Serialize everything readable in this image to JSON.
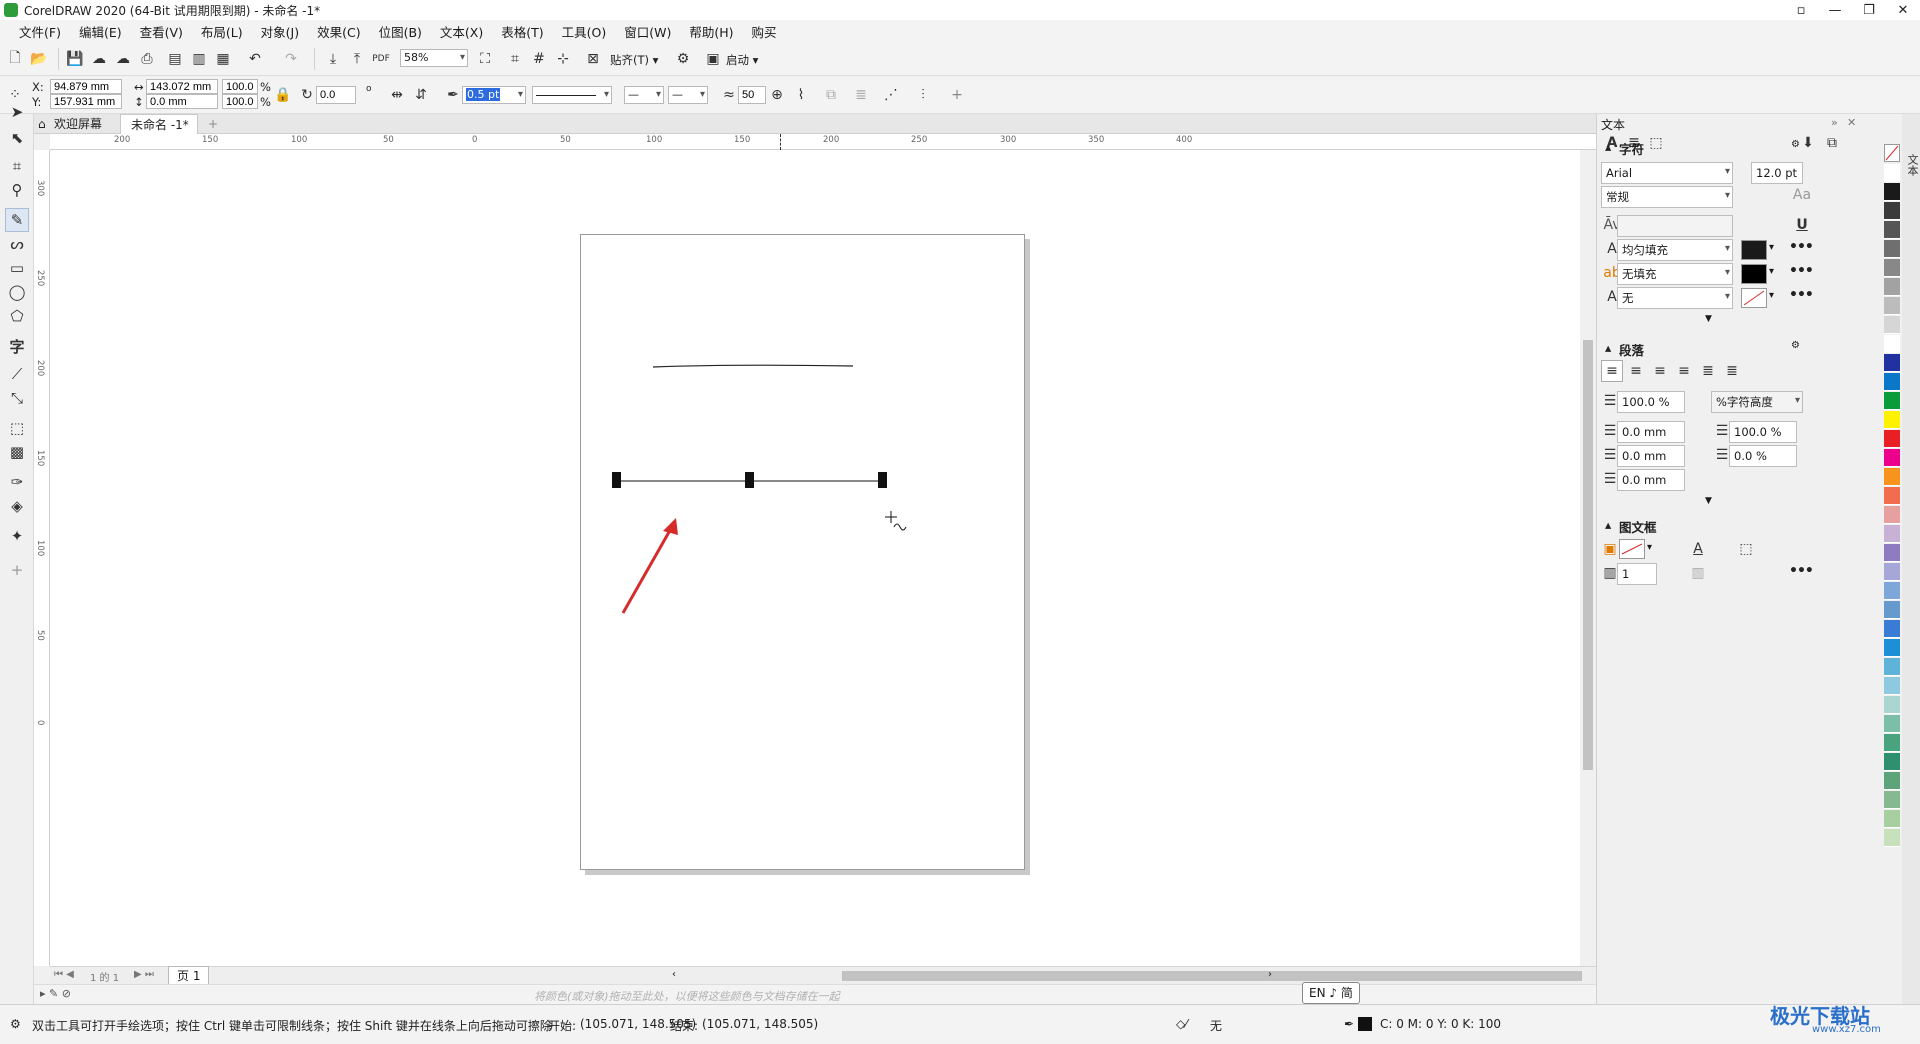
{
  "window": {
    "title": "CorelDRAW 2020 (64-Bit 试用期限到期) - 未命名 -1*"
  },
  "menu": [
    "文件(F)",
    "编辑(E)",
    "查看(V)",
    "布局(L)",
    "对象(J)",
    "效果(C)",
    "位图(B)",
    "文本(X)",
    "表格(T)",
    "工具(O)",
    "窗口(W)",
    "帮助(H)",
    "购买"
  ],
  "toolbar1": {
    "zoom": "58%",
    "snap_label": "贴齐(T)",
    "launch_label": "启动"
  },
  "toolbar2": {
    "x_label": "X:",
    "x_value": "94.879 mm",
    "y_label": "Y:",
    "y_value": "157.931 mm",
    "width_value": "143.072 mm",
    "height_value": "0.0 mm",
    "scale_x": "100.0",
    "scale_y": "100.0",
    "percent": "%",
    "rotation": "0.0",
    "degree": "o",
    "outline_width": "0.5 pt",
    "smoothing": "50"
  },
  "tabs": {
    "welcome": "欢迎屏幕",
    "document": "未命名 -1*"
  },
  "ruler_h": [
    "200",
    "150",
    "100",
    "50",
    "0",
    "50",
    "100",
    "150",
    "200",
    "250",
    "300",
    "350",
    "400"
  ],
  "ruler_v": [
    "300",
    "250",
    "200",
    "150",
    "100",
    "50",
    "0"
  ],
  "page_nav": {
    "count": "1 的 1",
    "page_tab": "页 1"
  },
  "tray_hint": "将颜色(或对象)拖动至此处，以便将这些颜色与文档存储在一起",
  "ime": "EN ♪ 简",
  "status": {
    "hint": "双击工具可打开手绘选项；按住 Ctrl 键单击可限制线条；按住 Shift 键并在线条上向后拖动可擦除",
    "start_label": "开始:",
    "start_value": "(105.071, 148.505)",
    "end_label": "结束:",
    "end_value": "(105.071, 148.505)",
    "fill_label": "无",
    "cmyk": "C: 0 M: 0 Y: 0 K: 100"
  },
  "panel": {
    "title": "文本",
    "section_char": "字符",
    "font_name": "Arial",
    "font_size": "12.0 pt",
    "font_style": "常规",
    "fill1": "均匀填充",
    "fill2": "无填充",
    "outline": "无",
    "section_para": "段落",
    "line_spacing": "100.0 %",
    "line_spacing_unit": "%字符高度",
    "para1": "0.0 mm",
    "para2": "100.0 %",
    "para3": "0.0 mm",
    "para4": "0.0 %",
    "para5": "0.0 mm",
    "section_frame": "图文框",
    "columns": "1"
  },
  "side_tab": "文本",
  "watermark": {
    "logo": "极光下载站",
    "url": "www.xz7.com"
  },
  "colors": {
    "accent": "#2e9c3a",
    "arrow": "#d62b2b",
    "palette": [
      "#ffffff",
      "#1a1a1a",
      "#3b3b3b",
      "#555555",
      "#6f6f6f",
      "#888888",
      "#a2a2a2",
      "#bcbcbc",
      "#d6d6d6",
      "#ffffff",
      "#2231a0",
      "#0a77c9",
      "#0b9b3a",
      "#fff200",
      "#e81f25",
      "#ec008c",
      "#f7941d",
      "#f26c4f",
      "#e6a0a0",
      "#c7b2d6",
      "#8e7cc3",
      "#a6a6d8",
      "#7fa6d9",
      "#6699cc",
      "#3a7bd5",
      "#1c8fd6",
      "#5fb3d9",
      "#8fc9e0",
      "#aad5d0",
      "#7bbfa8",
      "#4aa37f",
      "#2f8f6e",
      "#5fa37a",
      "#86b98f",
      "#a8cfa0",
      "#c7e1bd"
    ]
  }
}
